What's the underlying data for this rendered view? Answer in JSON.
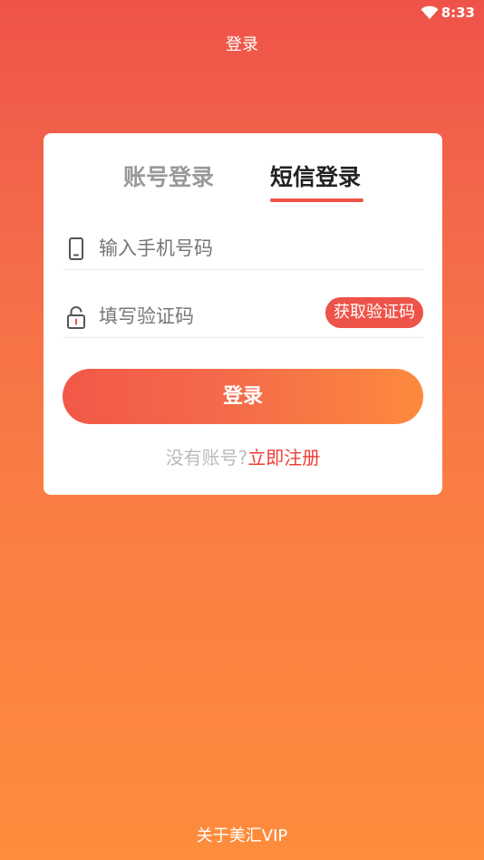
{
  "status_bar": {
    "time": "8:33",
    "wifi_icon": "wifi-icon"
  },
  "header": {
    "title": "登录"
  },
  "tabs": [
    {
      "label": "账号登录",
      "active": false
    },
    {
      "label": "短信登录",
      "active": true
    }
  ],
  "form": {
    "phone": {
      "placeholder": "输入手机号码",
      "value": "",
      "icon": "phone-icon"
    },
    "code": {
      "placeholder": "填写验证码",
      "value": "",
      "icon": "lock-icon"
    },
    "get_code_label": "获取验证码",
    "login_label": "登录"
  },
  "register": {
    "prompt": "没有账号?",
    "link": "立即注册"
  },
  "footer": {
    "about": "关于美汇VIP"
  },
  "colors": {
    "accent": "#ee5349",
    "gradient_top": "#ee5349",
    "gradient_bottom": "#fd8c3b",
    "register_link": "#ee3c35"
  }
}
